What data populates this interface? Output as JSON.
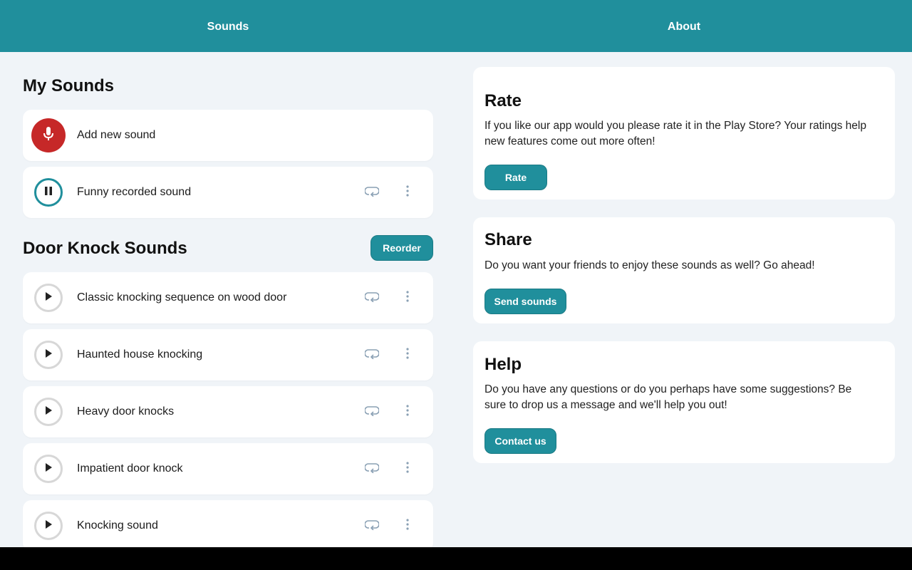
{
  "tabs": {
    "sounds": "Sounds",
    "about": "About"
  },
  "my_sounds": {
    "title": "My Sounds",
    "add_label": "Add new sound",
    "items": [
      {
        "label": "Funny recorded sound",
        "state": "playing"
      }
    ]
  },
  "door_knock": {
    "title": "Door Knock Sounds",
    "reorder_label": "Reorder",
    "items": [
      {
        "label": "Classic knocking sequence on wood door"
      },
      {
        "label": "Haunted house knocking"
      },
      {
        "label": "Heavy door knocks"
      },
      {
        "label": "Impatient door knock"
      },
      {
        "label": "Knocking sound"
      }
    ]
  },
  "about": {
    "rate": {
      "title": "Rate",
      "text": "If you like our app would you please rate it in the Play Store? Your ratings help new features come out more often!",
      "button": "Rate"
    },
    "share": {
      "title": "Share",
      "text": "Do you want your friends to enjoy these sounds as well? Go ahead!",
      "button": "Send sounds"
    },
    "help": {
      "title": "Help",
      "text": "Do you have any questions or do you perhaps have some suggestions? Be sure to drop us a message and we'll help you out!",
      "button": "Contact us"
    }
  },
  "colors": {
    "accent": "#208f9c",
    "record": "#c62828",
    "background": "#f0f4f8"
  },
  "icons": {
    "record": "microphone-icon",
    "pause": "pause-icon",
    "play": "play-icon",
    "loop": "loop-icon",
    "more": "more-vertical-icon"
  }
}
